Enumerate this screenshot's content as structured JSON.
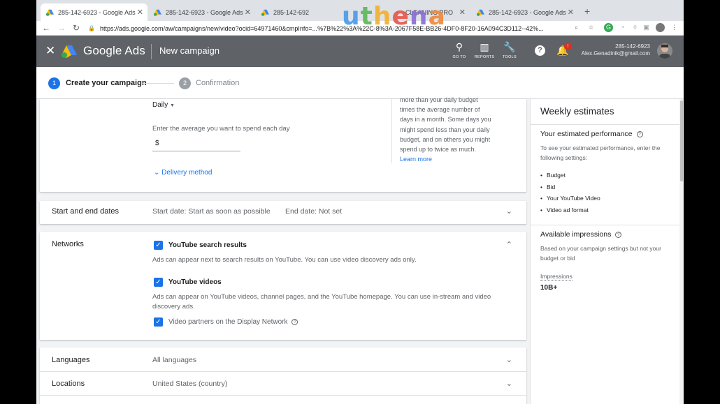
{
  "browser": {
    "tabs": [
      {
        "label": "285-142-6923 - Google Ads",
        "active": true
      },
      {
        "label": "285-142-6923 - Google Ads",
        "active": false
      },
      {
        "label": "285-142-692",
        "active": false
      },
      {
        "label": "CLEANING PRO",
        "active": false
      },
      {
        "label": "285-142-6923 - Google Ads",
        "active": false
      }
    ],
    "url": "https://ads.google.com/aw/campaigns/new/video?ocid=64971460&cmpInfo=...%7B%22%3A%22C-8%3A-2067F58E-BB26-4DF0-8F20-16A094C3D112--42%..."
  },
  "header": {
    "brand": "Google Ads",
    "page_title": "New campaign",
    "tools": [
      {
        "label": "GO TO"
      },
      {
        "label": "REPORTS"
      },
      {
        "label": "TOOLS"
      }
    ],
    "notification_count": "!",
    "account_id": "285-142-6923",
    "account_email": "Alex.Genadinik@gmail.com"
  },
  "stepper": {
    "steps": [
      {
        "num": "1",
        "label": "Create your campaign"
      },
      {
        "num": "2",
        "label": "Confirmation"
      }
    ]
  },
  "budget": {
    "type": "Daily",
    "hint": "Enter the average you want to spend each day",
    "currency": "$",
    "delivery_link": "Delivery method",
    "help_lines": [
      "more than your daily budget",
      "times the average number of",
      "days in a month. Some days you",
      "might spend less than your daily",
      "budget, and on others you might",
      "spend up to twice as much."
    ],
    "learn_more": "Learn more"
  },
  "dates": {
    "label": "Start and end dates",
    "start": "Start date: Start as soon as possible",
    "end": "End date: Not set"
  },
  "networks": {
    "label": "Networks",
    "options": [
      {
        "label": "YouTube search results",
        "desc": "Ads can appear next to search results on YouTube. You can use video discovery ads only."
      },
      {
        "label": "YouTube videos",
        "desc": "Ads can appear on YouTube videos, channel pages, and the YouTube homepage. You can use in-stream and video discovery ads."
      },
      {
        "label": "Video partners on the Display Network",
        "desc": ""
      }
    ]
  },
  "languages": {
    "label": "Languages",
    "value": "All languages"
  },
  "locations": {
    "label": "Locations",
    "value": "United States (country)"
  },
  "estimates": {
    "title": "Weekly estimates",
    "performance_title": "Your estimated performance",
    "performance_text": "To see your estimated performance, enter the following settings:",
    "settings": [
      "Budget",
      "Bid",
      "Your YouTube Video",
      "Video ad format"
    ],
    "impressions_title": "Available impressions",
    "impressions_text": "Based on your campaign settings but not your budget or bid",
    "impressions_label": "Impressions",
    "impressions_value": "10B+"
  },
  "watermark": [
    "u",
    "t",
    "h",
    "e",
    "n",
    "a"
  ],
  "colors": {
    "ads_header": "#5f6368",
    "accent_blue": "#1a73e8",
    "watermark": [
      "#4c9be8",
      "#5db85b",
      "#f2b233",
      "#e8574a",
      "#8c6fd6",
      "#f08a3c"
    ]
  }
}
